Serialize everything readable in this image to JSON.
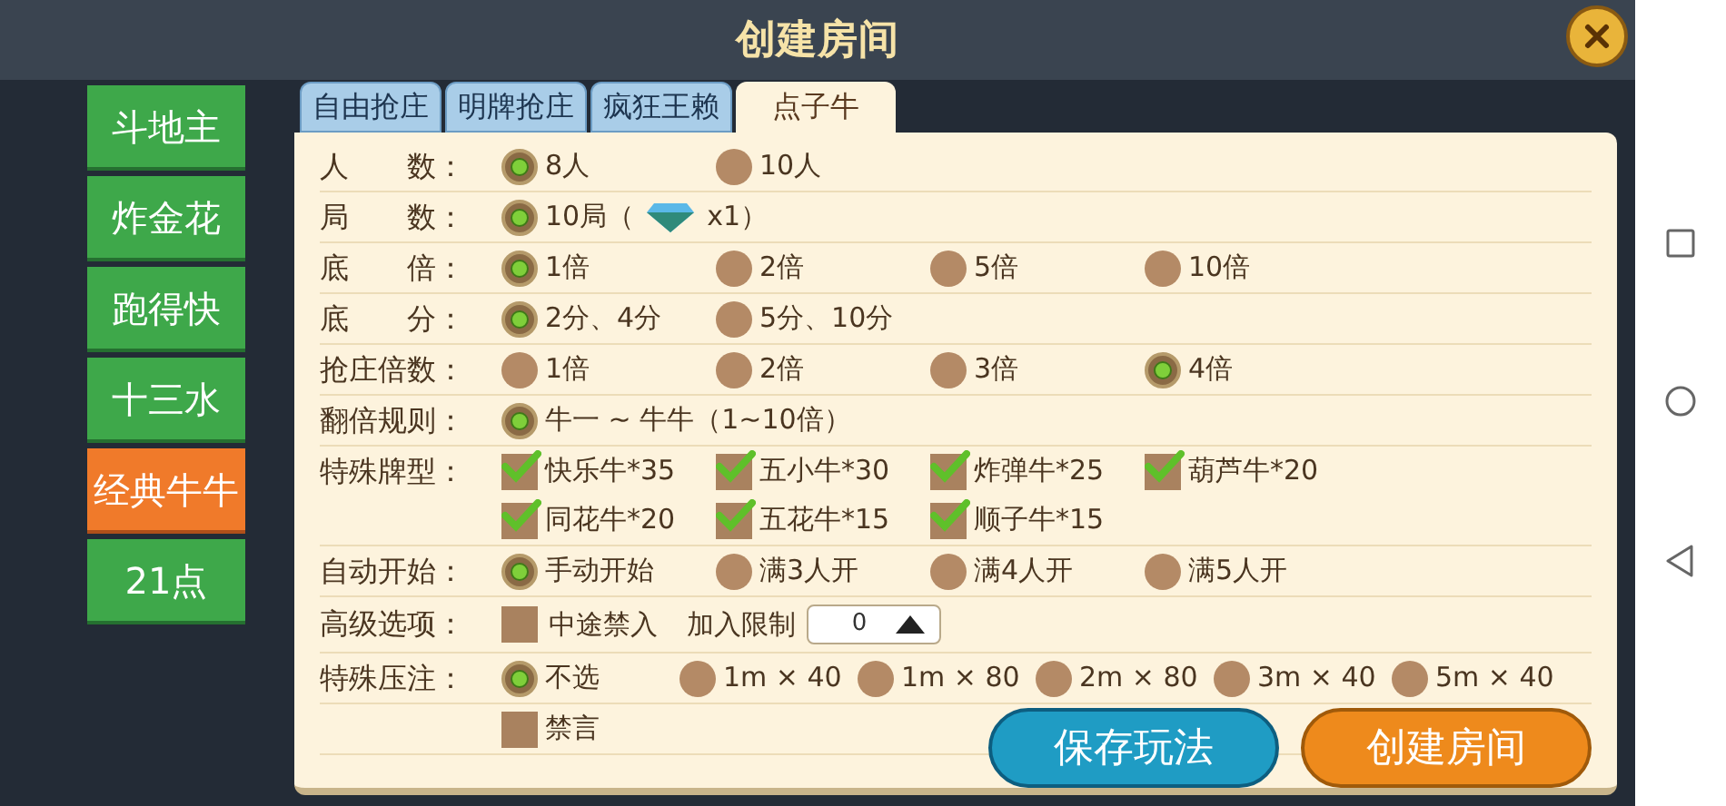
{
  "dialog": {
    "title": "创建房间"
  },
  "games": [
    {
      "label": "斗地主",
      "selected": false
    },
    {
      "label": "炸金花",
      "selected": false
    },
    {
      "label": "跑得快",
      "selected": false
    },
    {
      "label": "十三水",
      "selected": false
    },
    {
      "label": "经典牛牛",
      "selected": true
    },
    {
      "label": "21点",
      "selected": false
    }
  ],
  "tabs": [
    {
      "label": "自由抢庄",
      "selected": false
    },
    {
      "label": "明牌抢庄",
      "selected": false
    },
    {
      "label": "疯狂王赖",
      "selected": false
    },
    {
      "label": "点子牛",
      "selected": true
    }
  ],
  "rows": [
    {
      "kind": "radio",
      "label": "人　　数：",
      "options": [
        {
          "label": "8人",
          "selected": true
        },
        {
          "label": "10人",
          "selected": false
        }
      ]
    },
    {
      "kind": "radio",
      "label": "局　　数：",
      "options": [
        {
          "label": "10局（",
          "cost": "x1）",
          "selected": true
        }
      ]
    },
    {
      "kind": "radio",
      "label": "底　　倍：",
      "options": [
        {
          "label": "1倍",
          "selected": true
        },
        {
          "label": "2倍",
          "selected": false
        },
        {
          "label": "5倍",
          "selected": false
        },
        {
          "label": "10倍",
          "selected": false
        }
      ]
    },
    {
      "kind": "radio",
      "label": "底　　分：",
      "options": [
        {
          "label": "2分、4分",
          "selected": true
        },
        {
          "label": "5分、10分",
          "selected": false
        }
      ]
    },
    {
      "kind": "radio",
      "label": "抢庄倍数：",
      "options": [
        {
          "label": "1倍",
          "selected": false
        },
        {
          "label": "2倍",
          "selected": false
        },
        {
          "label": "3倍",
          "selected": false
        },
        {
          "label": "4倍",
          "selected": true
        }
      ]
    },
    {
      "kind": "radio",
      "label": "翻倍规则：",
      "options": [
        {
          "label": "牛一 ~ 牛牛（1~10倍）",
          "selected": true
        }
      ]
    },
    {
      "kind": "check",
      "label": "特殊牌型：",
      "options": [
        {
          "label": "快乐牛*35",
          "checked": true
        },
        {
          "label": "五小牛*30",
          "checked": true
        },
        {
          "label": "炸弹牛*25",
          "checked": true
        },
        {
          "label": "葫芦牛*20",
          "checked": true
        },
        {
          "label": "同花牛*20",
          "checked": true
        },
        {
          "label": "五花牛*15",
          "checked": true
        },
        {
          "label": "顺子牛*15",
          "checked": true
        }
      ]
    },
    {
      "kind": "radio",
      "label": "自动开始：",
      "options": [
        {
          "label": "手动开始",
          "selected": true
        },
        {
          "label": "满3人开",
          "selected": false
        },
        {
          "label": "满4人开",
          "selected": false
        },
        {
          "label": "满5人开",
          "selected": false
        }
      ]
    },
    {
      "kind": "advanced",
      "label": "高级选项：",
      "options": [
        {
          "label": "中途禁入",
          "checked": false
        }
      ],
      "limit_label": "加入限制",
      "limit_value": "0"
    },
    {
      "kind": "radio",
      "label": "特殊压注：",
      "options": [
        {
          "label": "不选",
          "selected": true
        },
        {
          "label": "1m × 40",
          "selected": false
        },
        {
          "label": "1m × 80",
          "selected": false
        },
        {
          "label": "2m × 80",
          "selected": false
        },
        {
          "label": "3m × 40",
          "selected": false
        },
        {
          "label": "5m × 40",
          "selected": false
        }
      ]
    },
    {
      "kind": "check",
      "options": [
        {
          "label": "禁言",
          "checked": false
        }
      ]
    }
  ],
  "buttons": [
    {
      "kind": "save",
      "label": "保存玩法"
    },
    {
      "kind": "create",
      "label": "创建房间"
    }
  ]
}
